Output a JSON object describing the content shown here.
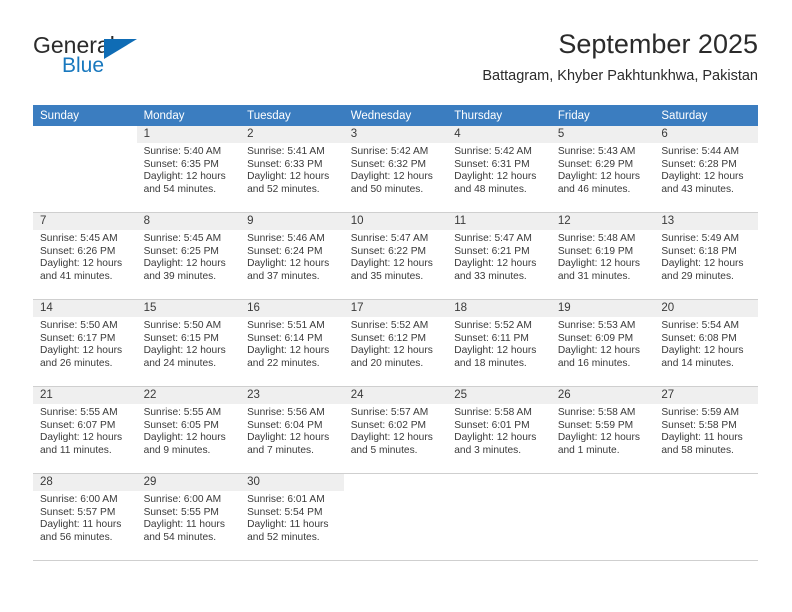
{
  "brand": {
    "name_top": "General",
    "name_bottom": "Blue",
    "logo_icon": "triangle-logo-icon",
    "accent_color": "#0f6cb5"
  },
  "header": {
    "title": "September 2025",
    "subtitle": "Battagram, Khyber Pakhtunkhwa, Pakistan"
  },
  "calendar": {
    "header_color": "#3b7dc0",
    "weekday_headers": [
      "Sunday",
      "Monday",
      "Tuesday",
      "Wednesday",
      "Thursday",
      "Friday",
      "Saturday"
    ],
    "weeks": [
      [
        {
          "day": "",
          "lines": []
        },
        {
          "day": "1",
          "lines": [
            "Sunrise: 5:40 AM",
            "Sunset: 6:35 PM",
            "Daylight: 12 hours",
            "and 54 minutes."
          ]
        },
        {
          "day": "2",
          "lines": [
            "Sunrise: 5:41 AM",
            "Sunset: 6:33 PM",
            "Daylight: 12 hours",
            "and 52 minutes."
          ]
        },
        {
          "day": "3",
          "lines": [
            "Sunrise: 5:42 AM",
            "Sunset: 6:32 PM",
            "Daylight: 12 hours",
            "and 50 minutes."
          ]
        },
        {
          "day": "4",
          "lines": [
            "Sunrise: 5:42 AM",
            "Sunset: 6:31 PM",
            "Daylight: 12 hours",
            "and 48 minutes."
          ]
        },
        {
          "day": "5",
          "lines": [
            "Sunrise: 5:43 AM",
            "Sunset: 6:29 PM",
            "Daylight: 12 hours",
            "and 46 minutes."
          ]
        },
        {
          "day": "6",
          "lines": [
            "Sunrise: 5:44 AM",
            "Sunset: 6:28 PM",
            "Daylight: 12 hours",
            "and 43 minutes."
          ]
        }
      ],
      [
        {
          "day": "7",
          "lines": [
            "Sunrise: 5:45 AM",
            "Sunset: 6:26 PM",
            "Daylight: 12 hours",
            "and 41 minutes."
          ]
        },
        {
          "day": "8",
          "lines": [
            "Sunrise: 5:45 AM",
            "Sunset: 6:25 PM",
            "Daylight: 12 hours",
            "and 39 minutes."
          ]
        },
        {
          "day": "9",
          "lines": [
            "Sunrise: 5:46 AM",
            "Sunset: 6:24 PM",
            "Daylight: 12 hours",
            "and 37 minutes."
          ]
        },
        {
          "day": "10",
          "lines": [
            "Sunrise: 5:47 AM",
            "Sunset: 6:22 PM",
            "Daylight: 12 hours",
            "and 35 minutes."
          ]
        },
        {
          "day": "11",
          "lines": [
            "Sunrise: 5:47 AM",
            "Sunset: 6:21 PM",
            "Daylight: 12 hours",
            "and 33 minutes."
          ]
        },
        {
          "day": "12",
          "lines": [
            "Sunrise: 5:48 AM",
            "Sunset: 6:19 PM",
            "Daylight: 12 hours",
            "and 31 minutes."
          ]
        },
        {
          "day": "13",
          "lines": [
            "Sunrise: 5:49 AM",
            "Sunset: 6:18 PM",
            "Daylight: 12 hours",
            "and 29 minutes."
          ]
        }
      ],
      [
        {
          "day": "14",
          "lines": [
            "Sunrise: 5:50 AM",
            "Sunset: 6:17 PM",
            "Daylight: 12 hours",
            "and 26 minutes."
          ]
        },
        {
          "day": "15",
          "lines": [
            "Sunrise: 5:50 AM",
            "Sunset: 6:15 PM",
            "Daylight: 12 hours",
            "and 24 minutes."
          ]
        },
        {
          "day": "16",
          "lines": [
            "Sunrise: 5:51 AM",
            "Sunset: 6:14 PM",
            "Daylight: 12 hours",
            "and 22 minutes."
          ]
        },
        {
          "day": "17",
          "lines": [
            "Sunrise: 5:52 AM",
            "Sunset: 6:12 PM",
            "Daylight: 12 hours",
            "and 20 minutes."
          ]
        },
        {
          "day": "18",
          "lines": [
            "Sunrise: 5:52 AM",
            "Sunset: 6:11 PM",
            "Daylight: 12 hours",
            "and 18 minutes."
          ]
        },
        {
          "day": "19",
          "lines": [
            "Sunrise: 5:53 AM",
            "Sunset: 6:09 PM",
            "Daylight: 12 hours",
            "and 16 minutes."
          ]
        },
        {
          "day": "20",
          "lines": [
            "Sunrise: 5:54 AM",
            "Sunset: 6:08 PM",
            "Daylight: 12 hours",
            "and 14 minutes."
          ]
        }
      ],
      [
        {
          "day": "21",
          "lines": [
            "Sunrise: 5:55 AM",
            "Sunset: 6:07 PM",
            "Daylight: 12 hours",
            "and 11 minutes."
          ]
        },
        {
          "day": "22",
          "lines": [
            "Sunrise: 5:55 AM",
            "Sunset: 6:05 PM",
            "Daylight: 12 hours",
            "and 9 minutes."
          ]
        },
        {
          "day": "23",
          "lines": [
            "Sunrise: 5:56 AM",
            "Sunset: 6:04 PM",
            "Daylight: 12 hours",
            "and 7 minutes."
          ]
        },
        {
          "day": "24",
          "lines": [
            "Sunrise: 5:57 AM",
            "Sunset: 6:02 PM",
            "Daylight: 12 hours",
            "and 5 minutes."
          ]
        },
        {
          "day": "25",
          "lines": [
            "Sunrise: 5:58 AM",
            "Sunset: 6:01 PM",
            "Daylight: 12 hours",
            "and 3 minutes."
          ]
        },
        {
          "day": "26",
          "lines": [
            "Sunrise: 5:58 AM",
            "Sunset: 5:59 PM",
            "Daylight: 12 hours",
            "and 1 minute."
          ]
        },
        {
          "day": "27",
          "lines": [
            "Sunrise: 5:59 AM",
            "Sunset: 5:58 PM",
            "Daylight: 11 hours",
            "and 58 minutes."
          ]
        }
      ],
      [
        {
          "day": "28",
          "lines": [
            "Sunrise: 6:00 AM",
            "Sunset: 5:57 PM",
            "Daylight: 11 hours",
            "and 56 minutes."
          ]
        },
        {
          "day": "29",
          "lines": [
            "Sunrise: 6:00 AM",
            "Sunset: 5:55 PM",
            "Daylight: 11 hours",
            "and 54 minutes."
          ]
        },
        {
          "day": "30",
          "lines": [
            "Sunrise: 6:01 AM",
            "Sunset: 5:54 PM",
            "Daylight: 11 hours",
            "and 52 minutes."
          ]
        },
        {
          "day": "",
          "lines": []
        },
        {
          "day": "",
          "lines": []
        },
        {
          "day": "",
          "lines": []
        },
        {
          "day": "",
          "lines": []
        }
      ]
    ]
  }
}
